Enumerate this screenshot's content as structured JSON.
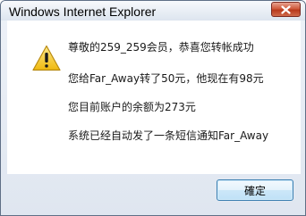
{
  "window": {
    "title": "Windows Internet Explorer"
  },
  "titlebar": {
    "close_icon": "close-icon"
  },
  "dialog": {
    "icon": "warning-icon",
    "lines": [
      "尊敬的259_259会员，恭喜您转帐成功",
      "您给Far_Away转了50元，他现在有98元",
      "您目前账户的余额为273元",
      "系统已经自动发了一条短信通知Far_Away"
    ]
  },
  "buttons": {
    "ok_label": "確定"
  },
  "colors": {
    "close_button": "#c64a2d",
    "warning_yellow": "#f5c722",
    "ok_border": "#3c7fb1"
  }
}
